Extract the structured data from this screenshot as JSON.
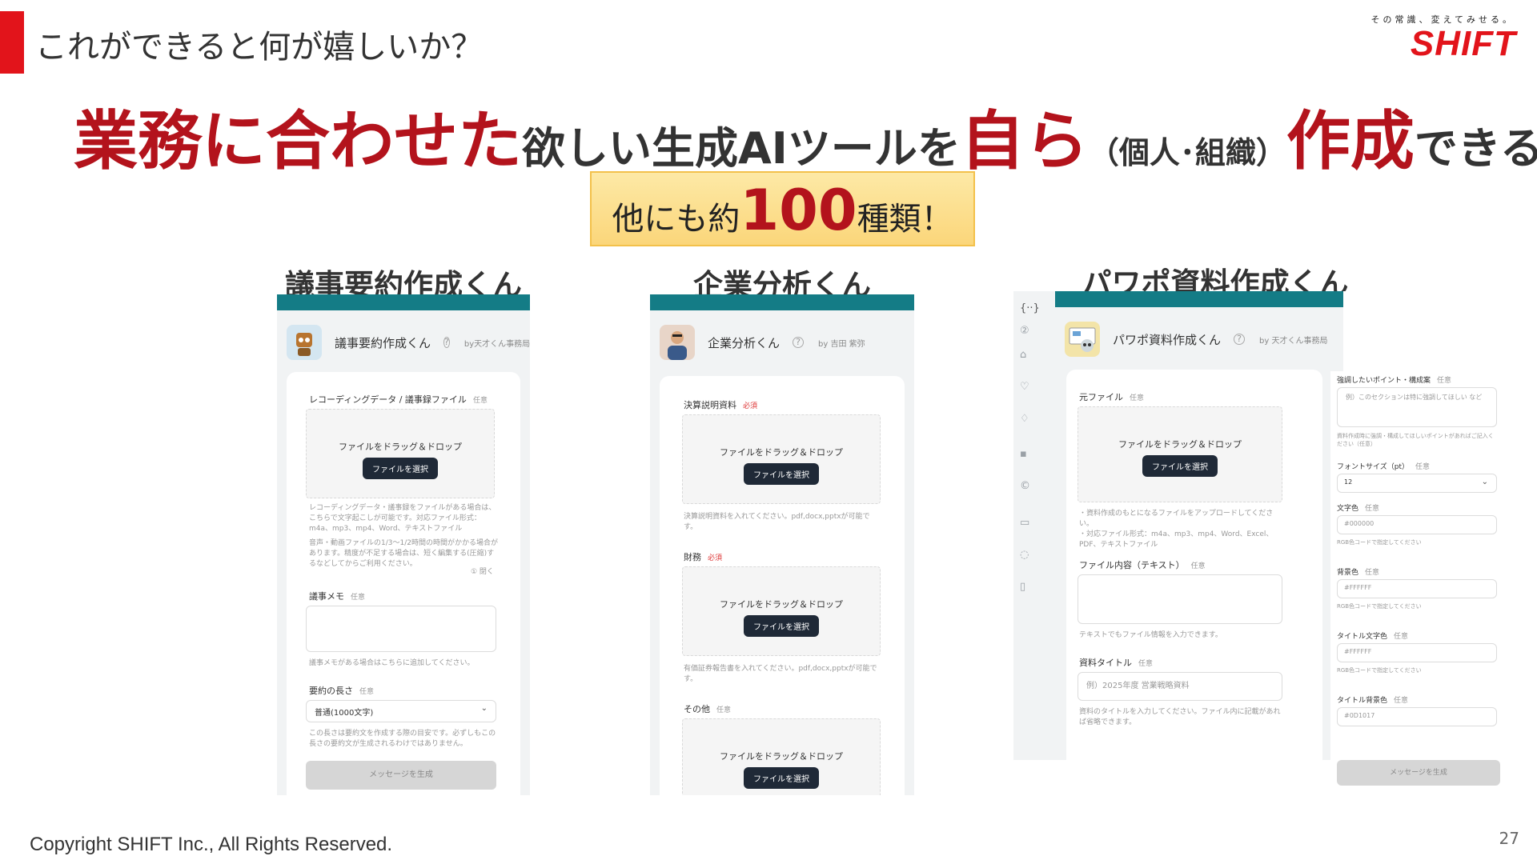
{
  "slide": {
    "title": "これができると何が嬉しいか？",
    "page_number": "27",
    "copyright": "Copyright SHIFT Inc., All Rights Reserved."
  },
  "logo": {
    "tagline": "その常識、変えてみせる。",
    "wordmark": "SHIFT",
    "color": "#e2141b"
  },
  "headline": {
    "part1": "業務に合わせた",
    "part2": "欲しい生成AIツールを",
    "part3": "自ら",
    "part4": "（個人･組織）",
    "part5": "作成",
    "part6": "できる"
  },
  "callout": {
    "prefix": "他にも約",
    "number": "100",
    "suffix": "種類！"
  },
  "cards": [
    {
      "title": "議事要約作成くん",
      "app_name": "議事要約作成くん",
      "byline": "by天才くん事務局",
      "section1_label": "レコーディングデータ / 議事録ファイル",
      "optional": "任意",
      "drop_text": "ファイルをドラッグ＆ドロップ",
      "pick_label": "ファイルを選択",
      "help1": "レコーディングデータ・議事録をファイルがある場合は、こちらで文字起こしが可能です。対応ファイル形式：m4a、mp3、mp4、Word、テキストファイル",
      "help2": "音声・動画ファイルの1/3〜1/2時間の時間がかかる場合があります。精度が不足する場合は、短く編集する(圧縮)するなどしてからご利用ください。",
      "collapse": "① 閉く",
      "section2_label": "議事メモ",
      "help3": "議事メモがある場合はこちらに追加してください。",
      "section3_label": "要約の長さ",
      "select_value": "普通(1000文字)",
      "help4": "この長さは要約文を作成する際の目安です。必ずしもこの長さの要約文が生成されるわけではありません。",
      "generate": "メッセージを生成"
    },
    {
      "title": "企業分析くん",
      "app_name": "企業分析くん",
      "byline": "by 吉田 紫弥",
      "section1_label": "決算説明資料",
      "required": "必須",
      "drop_text": "ファイルをドラッグ＆ドロップ",
      "pick_label": "ファイルを選択",
      "help1": "決算説明資料を入れてください。pdf,docx,pptxが可能です。",
      "section2_label": "財務",
      "help2": "有価証券報告書を入れてください。pdf,docx,pptxが可能です。",
      "section3_label": "その他",
      "optional": "任意"
    },
    {
      "title": "パワポ資料作成くん",
      "app_name": "パワポ資料作成くん",
      "byline": "by 天才くん事務局",
      "section1_label": "元ファイル",
      "optional": "任意",
      "drop_text": "ファイルをドラッグ＆ドロップ",
      "pick_label": "ファイルを選択",
      "help1": "・資料作成のもとになるファイルをアップロードしてください。",
      "help2": "・対応ファイル形式：m4a、mp3、mp4、Word、Excel、PDF、テキストファイル",
      "section2_label": "ファイル内容（テキスト）",
      "help3": "テキストでもファイル情報を入力できます。",
      "section3_label": "資料タイトル",
      "title_placeholder": "例）2025年度 営業戦略資料",
      "help4": "資料のタイトルを入力してください。ファイル内に記載があれば省略できます。",
      "right": {
        "points_label": "強調したいポイント・構成案",
        "points_placeholder": "例）このセクションは特に強調してほしい など",
        "points_help": "資料作成時に強調・構成してほしいポイントがあればご記入ください（任意）",
        "font_label": "フォントサイズ（pt）",
        "font_value": "12",
        "color_label": "文字色",
        "color_value": "#000000",
        "color_help": "RGB色コードで指定してください",
        "bg_label": "背景色",
        "bg_value": "#FFFFFF",
        "bg_help": "RGB色コードで指定してください",
        "tcolor_label": "タイトル文字色",
        "tcolor_value": "#FFFFFF",
        "tcolor_help": "RGB色コードで指定してください",
        "tbg_label": "タイトル背景色",
        "tbg_value": "#0D1017",
        "generate": "メッセージを生成"
      }
    }
  ],
  "colors": {
    "accent_red": "#b3131c",
    "teal": "#147c86",
    "callout_bg": "#fbd67a"
  },
  "icons": [
    "robot-avatar",
    "businessman-avatar",
    "presentation-robot-avatar",
    "help-icon",
    "sidebar-menu-icon",
    "home-icon",
    "heart-icon",
    "bell-icon",
    "chat-icon",
    "book-icon",
    "document-icon"
  ]
}
